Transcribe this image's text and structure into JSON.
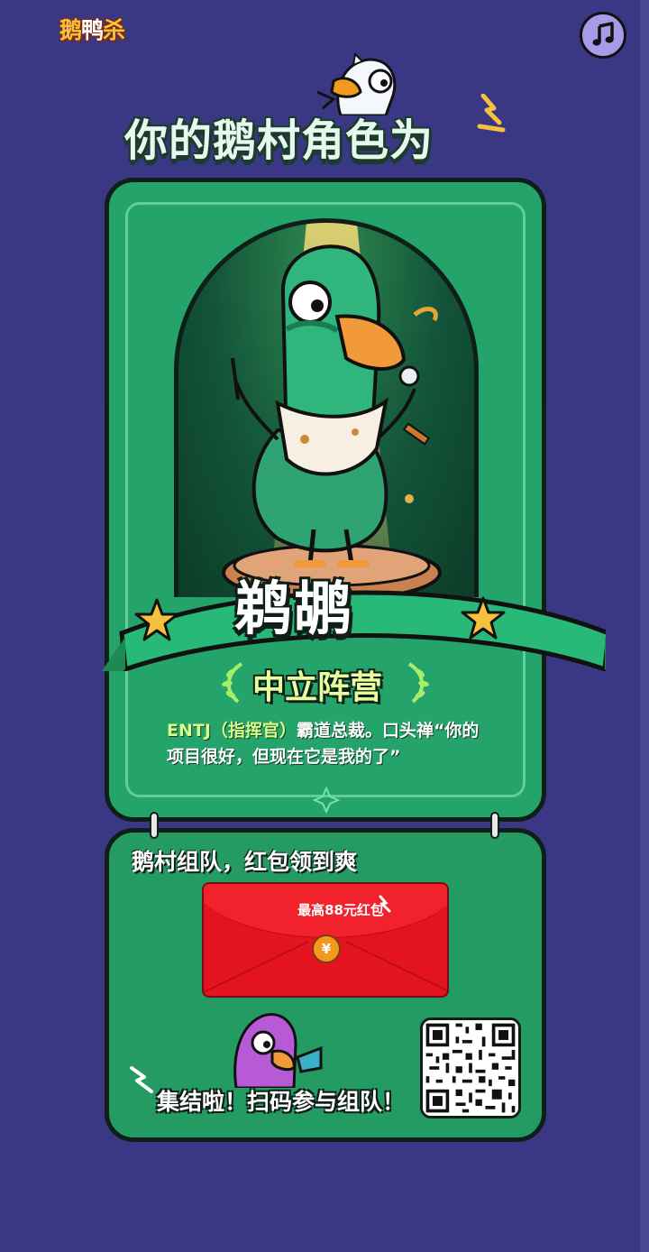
{
  "header": {
    "logo_text": "鹅鸭杀",
    "logo_part1": "鹅",
    "logo_part2": "鸭",
    "logo_part3": "杀",
    "music_icon": "music-note-icon"
  },
  "result": {
    "headline": "你的鹅村角色为",
    "character_name": "鹈鹕",
    "camp": "中立阵营",
    "description_prefix": "ENTJ",
    "description_role": "（指挥官）",
    "description_body": "霸道总裁。口头禅“你的项目很好，但现在它是我的了”"
  },
  "team": {
    "title": "鹅村组队，红包领到爽",
    "red_packet_label": "最高88元红包",
    "coin_symbol": "¥",
    "rally_text": "集结啦！扫码参与组队！"
  },
  "colors": {
    "background": "#3a3784",
    "card_green": "#24a36a",
    "outline": "#0f1e18",
    "red_packet": "#e3141f",
    "accent_yellow": "#f6c23e"
  }
}
